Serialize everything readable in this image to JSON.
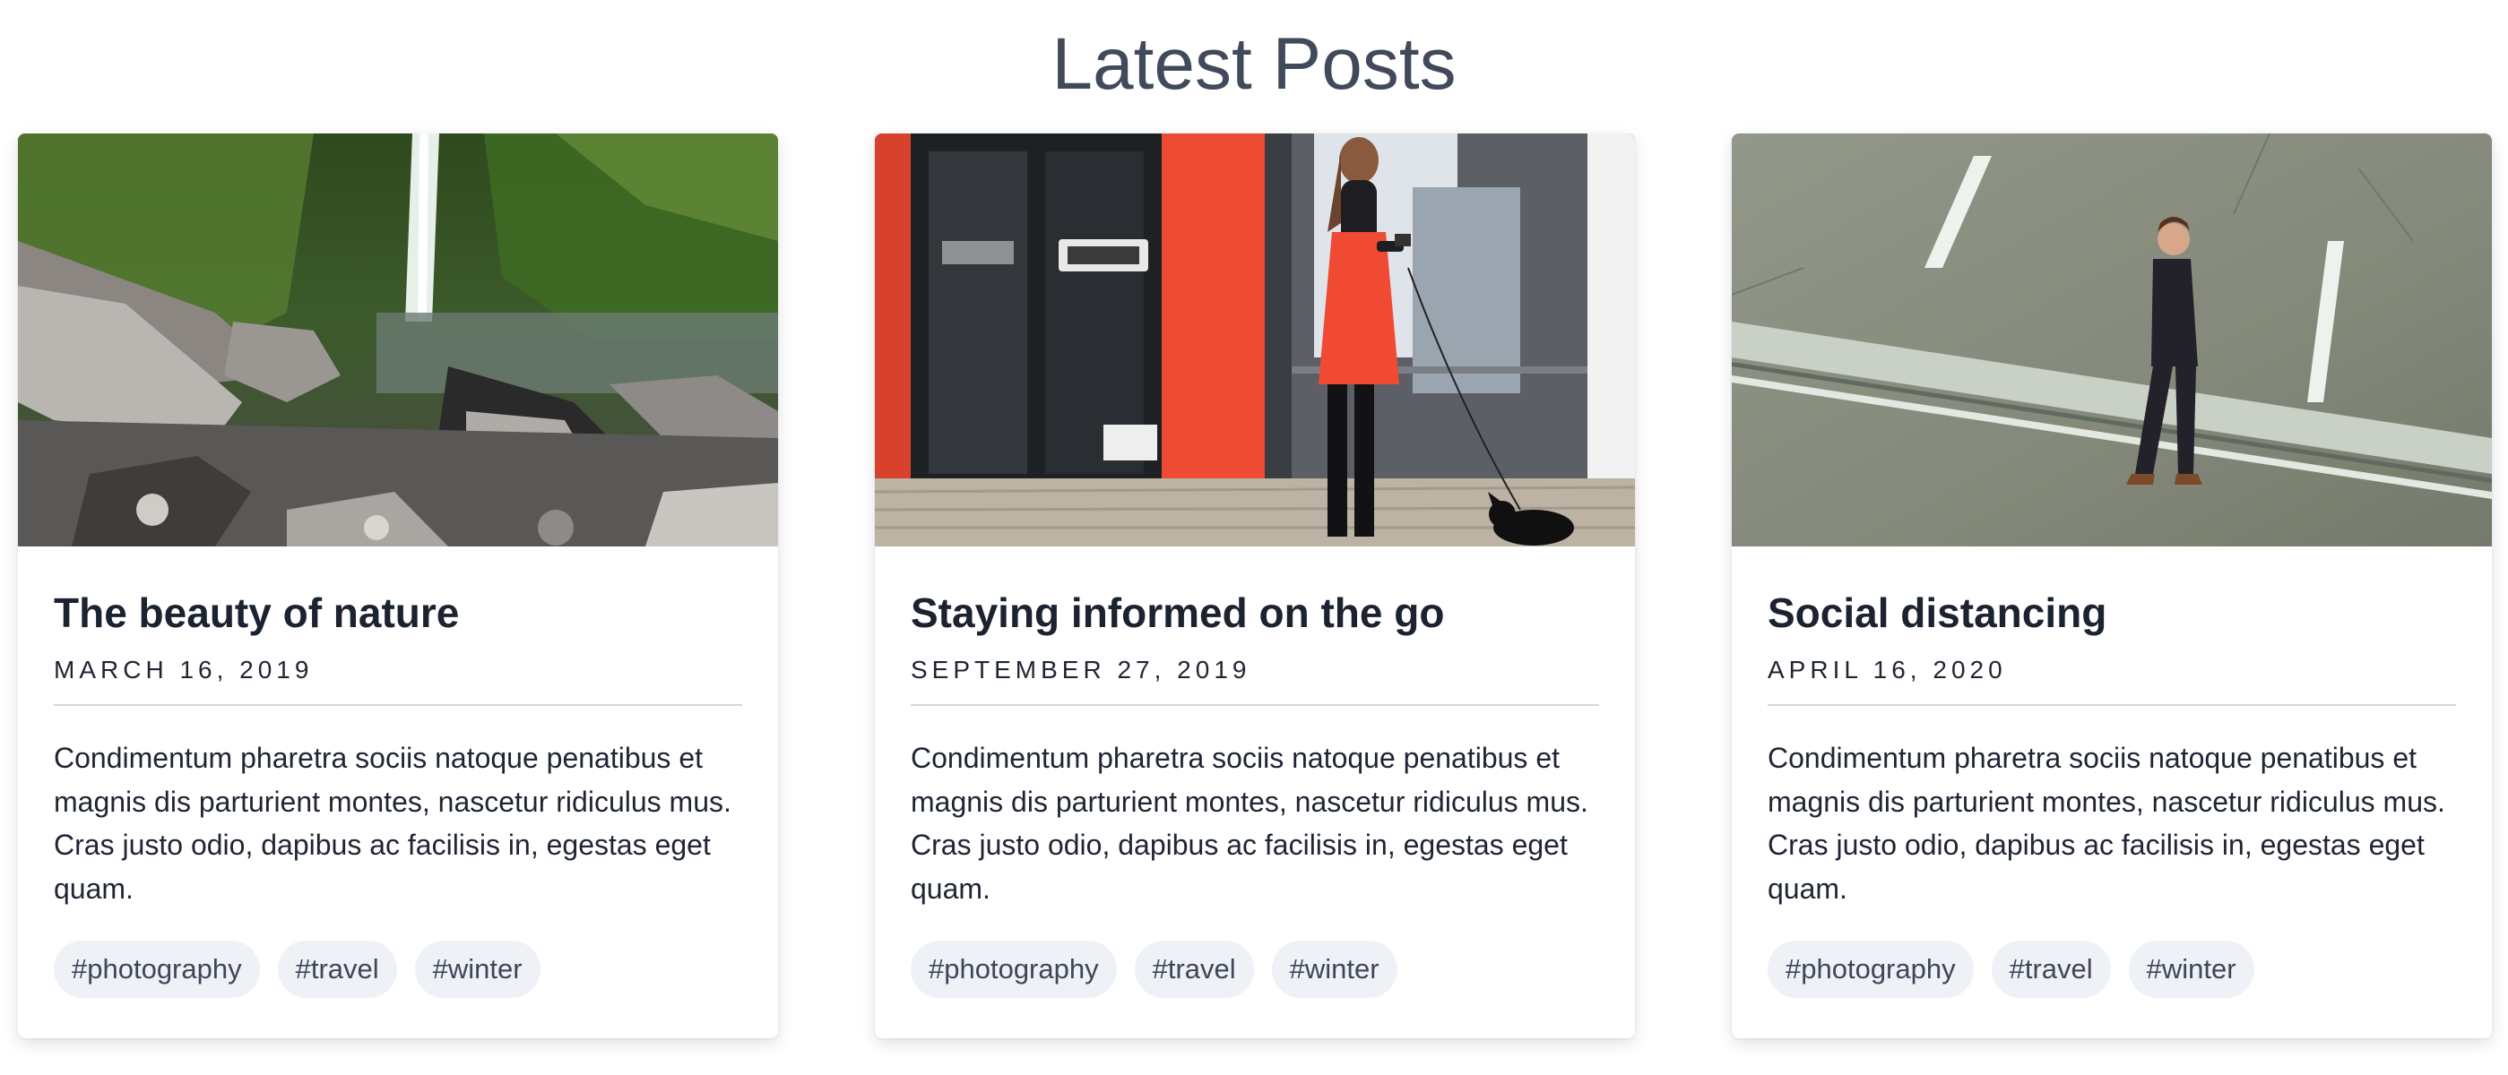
{
  "page": {
    "title": "Latest Posts"
  },
  "posts": [
    {
      "title": "The beauty of nature",
      "date": "MARCH 16, 2019",
      "excerpt": "Condimentum pharetra sociis natoque penatibus et magnis dis parturient montes, nascetur ridiculus mus. Cras justo odio, dapibus ac facilisis in, egestas eget quam.",
      "tags": [
        "#photography",
        "#travel",
        "#winter"
      ],
      "image_subject": "waterfall-rocks-photo"
    },
    {
      "title": "Staying informed on the go",
      "date": "SEPTEMBER 27, 2019",
      "excerpt": "Condimentum pharetra sociis natoque penatibus et magnis dis parturient montes, nascetur ridiculus mus. Cras justo odio, dapibus ac facilisis in, egestas eget quam.",
      "tags": [
        "#photography",
        "#travel",
        "#winter"
      ],
      "image_subject": "woman-with-phone-and-dog-photo"
    },
    {
      "title": "Social distancing",
      "date": "APRIL 16, 2020",
      "excerpt": "Condimentum pharetra sociis natoque penatibus et magnis dis parturient montes, nascetur ridiculus mus. Cras justo odio, dapibus ac facilisis in, egestas eget quam.",
      "tags": [
        "#photography",
        "#travel",
        "#winter"
      ],
      "image_subject": "man-walking-on-street-photo"
    }
  ],
  "colors": {
    "title": "#414a5b",
    "heading": "#1b2230",
    "body_text": "#1f2533",
    "tag_bg": "#eef1f6",
    "tag_text": "#3e4658",
    "divider": "#d3d6dc"
  }
}
